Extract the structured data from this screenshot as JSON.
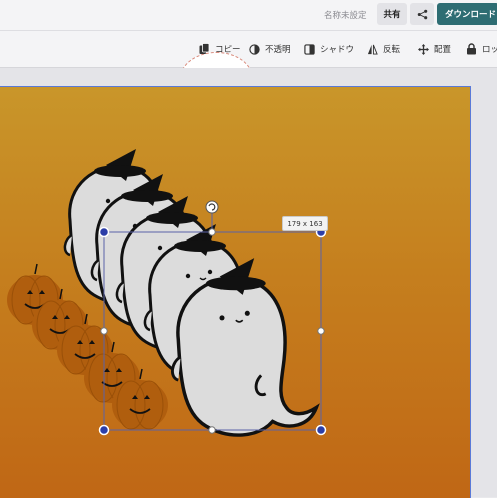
{
  "topbar": {
    "doc_title": "名称未設定",
    "share_label": "共有",
    "connect_icon": "share-nodes-icon",
    "download_label": "ダウンロード",
    "download_color": "#2e6d73"
  },
  "toolbar": {
    "copy_label": "コピー",
    "opacity_label": "不透明",
    "shadow_label": "シャドウ",
    "flip_label": "反転",
    "arrange_label": "配置",
    "lock_label": "ロッ"
  },
  "selection": {
    "size_label": "179 x 163",
    "handle_color": "#2c3ea8"
  },
  "artboard": {
    "gradient_top": "#c9962a",
    "gradient_bottom": "#c06715"
  }
}
